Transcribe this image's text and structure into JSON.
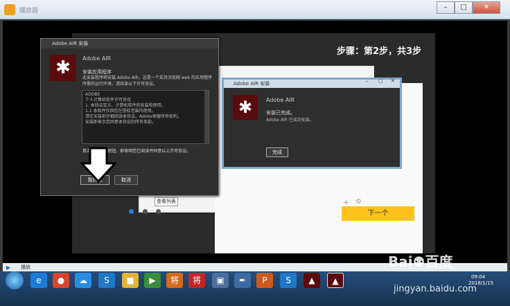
{
  "window": {
    "title": "播放器",
    "min": "–",
    "max": "□",
    "close": "✕"
  },
  "slide": {
    "step_label": "步骤：第2步，共3步"
  },
  "background_page": {
    "next_button": "下一个",
    "list_button": "查看列表",
    "plus": "+",
    "gear": "⚙"
  },
  "dialog1": {
    "title": "Adobe AIR 安装",
    "heading": "Adobe AIR",
    "subheading": "安装应用程序",
    "description": "此安装程序将安装 Adobe AIR，这是一个支持浏览网 web 的应用程序所需的运行环境，请阅读以下许可协议。",
    "license_lines": [
      "ADOBE",
      "个人计算机软件许可协议",
      "1. 本协议定义、计算机软件的安装和使用。",
      "1.1 本软件仅供您在授权范围内使用。",
      "请在安装前仔细阅读本协议。Adobe保留所有权利。",
      "安装即表示您同意本协议的所有条款。"
    ],
    "agree_text": "单击“我同意”按钮，即表明您已阅读并同意以上许可协议。",
    "install_button": "我同意",
    "cancel_button": "取消"
  },
  "dialog2": {
    "title": "Adobe AIR 安装",
    "heading": "Adobe AIR",
    "status": "安装已完成。",
    "detail": "Adobe AIR 已成功安装。",
    "finish_button": "完成",
    "min": "–",
    "max": "□",
    "close": "✕"
  },
  "player_bar": {
    "text": "播放"
  },
  "taskbar": {
    "time": "09:04",
    "date": "2018/1/15",
    "icons": [
      "e",
      "●",
      "☁",
      "S",
      "■",
      "▶",
      "将",
      "▣",
      "✒",
      "P",
      "S",
      "▲",
      "▲"
    ]
  },
  "watermark": {
    "brand": "Bai⚉百度",
    "url": "jingyan.baidu.com"
  },
  "colors": {
    "air_logo": "#5a0c0c",
    "next_button": "#ffc21a",
    "taskbar": "#1e3f66"
  }
}
